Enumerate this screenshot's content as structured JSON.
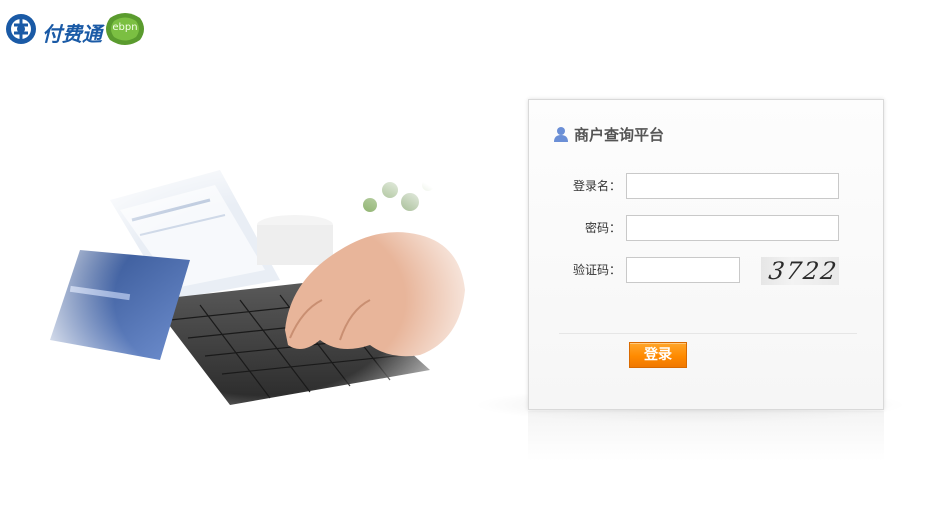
{
  "header": {
    "brand_name": "付费通",
    "partner_logo_text": "ebpn"
  },
  "login": {
    "title": "商户查询平台",
    "username_label": "登录名：",
    "username_value": "",
    "password_label": "密码：",
    "password_value": "",
    "captcha_label": "验证码：",
    "captcha_value": "",
    "captcha_image_text": "3722",
    "submit_label": "登录"
  },
  "colors": {
    "brand_blue": "#1a5aa6",
    "button_orange": "#ff8a00",
    "title_gray": "#555555"
  },
  "icons": [
    "brand-logo-icon",
    "user-icon"
  ]
}
